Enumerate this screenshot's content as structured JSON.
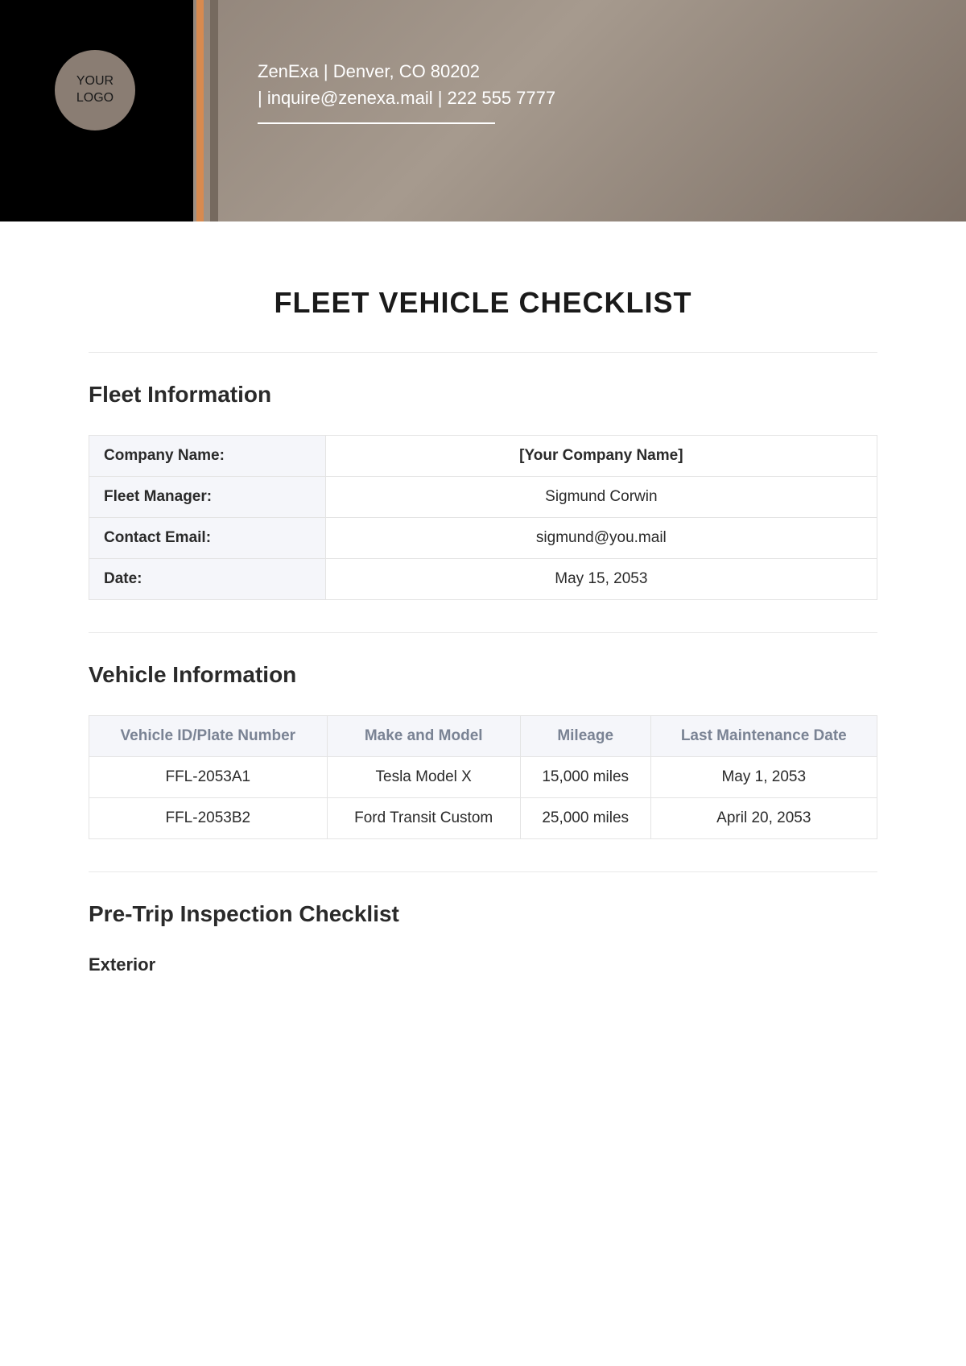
{
  "header": {
    "logo_line1": "YOUR",
    "logo_line2": "LOGO",
    "company_line1": "ZenExa | Denver, CO 80202",
    "company_line2": "| inquire@zenexa.mail | 222 555 7777"
  },
  "main_title": "FLEET VEHICLE CHECKLIST",
  "fleet_info": {
    "title": "Fleet Information",
    "rows": [
      {
        "label": "Company Name:",
        "value": "[Your Company Name]"
      },
      {
        "label": "Fleet Manager:",
        "value": "Sigmund Corwin"
      },
      {
        "label": "Contact Email:",
        "value": "sigmund@you.mail"
      },
      {
        "label": "Date:",
        "value": "May 15, 2053"
      }
    ]
  },
  "vehicle_info": {
    "title": "Vehicle Information",
    "headers": [
      "Vehicle ID/Plate Number",
      "Make and Model",
      "Mileage",
      "Last Maintenance Date"
    ],
    "rows": [
      [
        "FFL-2053A1",
        "Tesla Model X",
        "15,000 miles",
        "May 1, 2053"
      ],
      [
        "FFL-2053B2",
        "Ford Transit Custom",
        "25,000 miles",
        "April 20, 2053"
      ]
    ]
  },
  "checklist": {
    "title": "Pre-Trip Inspection Checklist",
    "subsection": "Exterior"
  }
}
